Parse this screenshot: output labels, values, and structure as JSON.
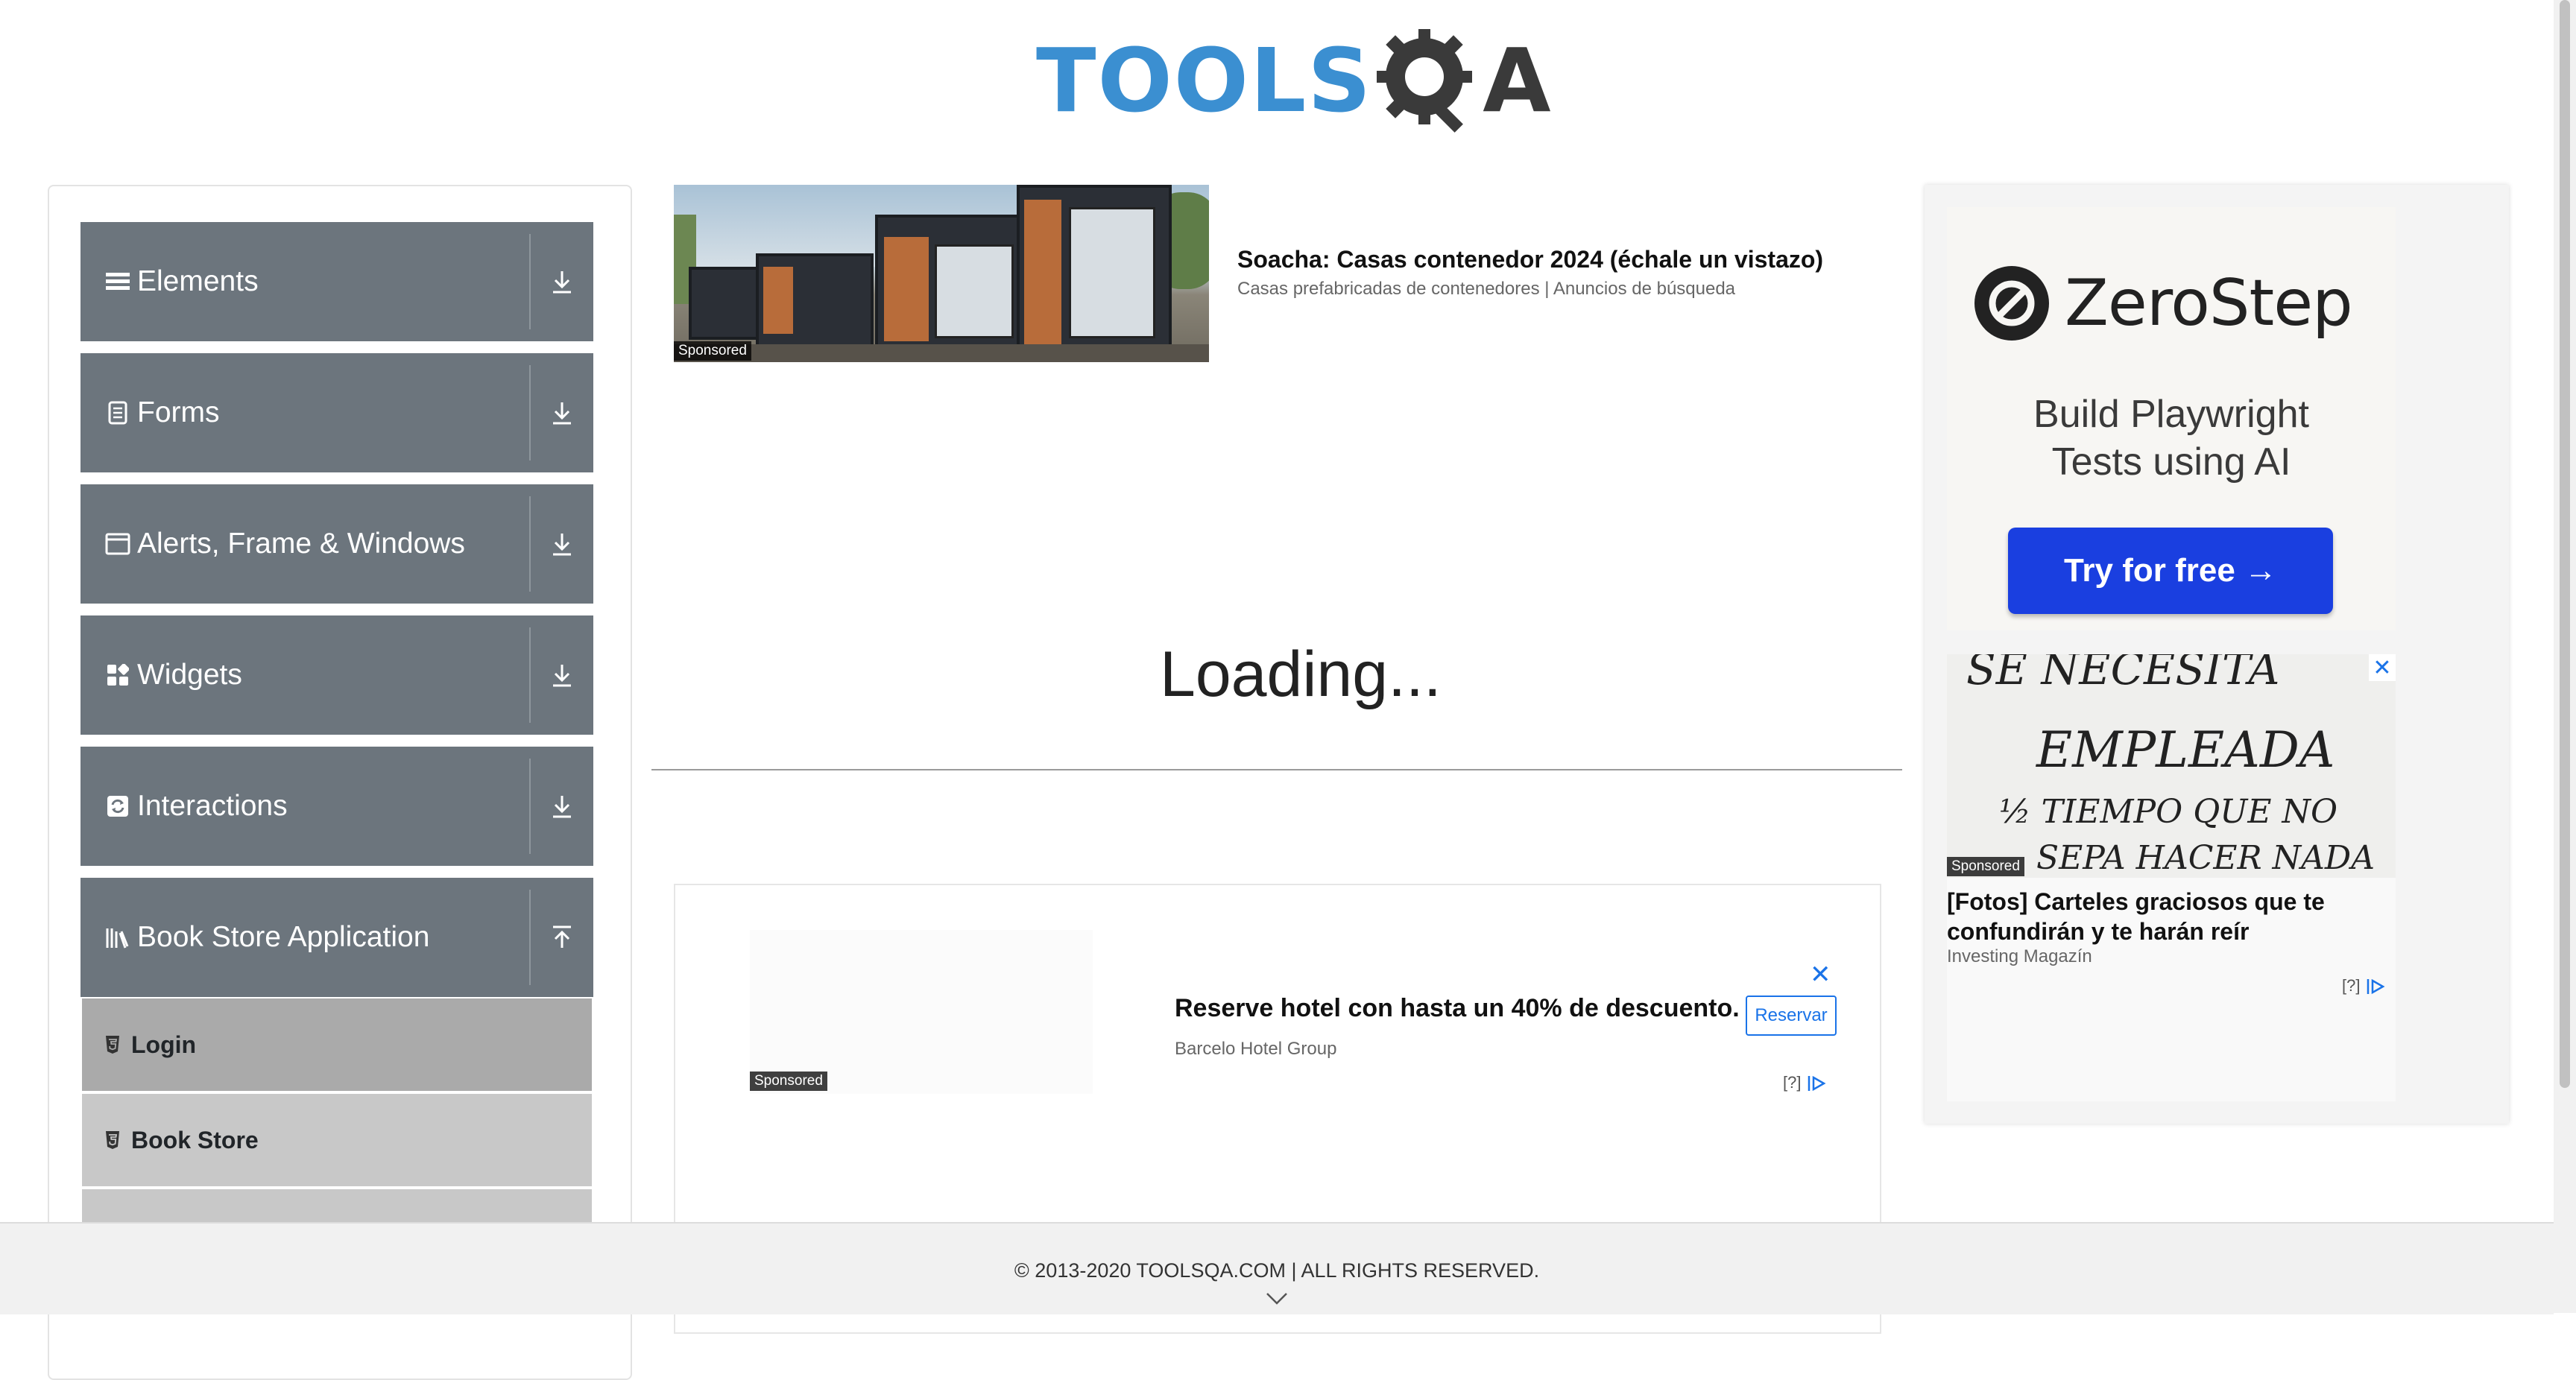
{
  "header": {
    "logo_text_a": "TOOLS",
    "logo_text_b": "A"
  },
  "sidebar": {
    "groups": [
      {
        "label": "Elements",
        "icon": "hamburger-icon",
        "arrow": "download-icon"
      },
      {
        "label": "Forms",
        "icon": "document-icon",
        "arrow": "download-icon"
      },
      {
        "label": "Alerts, Frame & Windows",
        "icon": "window-icon",
        "arrow": "download-icon"
      },
      {
        "label": "Widgets",
        "icon": "grid-icon",
        "arrow": "download-icon"
      },
      {
        "label": "Interactions",
        "icon": "refresh-icon",
        "arrow": "download-icon"
      },
      {
        "label": "Book Store Application",
        "icon": "library-icon",
        "arrow": "upload-icon"
      }
    ],
    "book_store_items": [
      {
        "label": "Login",
        "active": true
      },
      {
        "label": "Book Store",
        "active": false
      },
      {
        "label": "",
        "active": false
      }
    ]
  },
  "ad_top": {
    "badge": "Sponsored",
    "title": "Soacha: Casas contenedor 2024 (échale un vistazo)",
    "subtitle": "Casas prefabricadas de contenedores | Anuncios de búsqueda"
  },
  "main": {
    "loading": "Loading..."
  },
  "ad_mid": {
    "title": "Reserve hotel con hasta un 40% de descuento.",
    "source": "Barcelo Hotel Group",
    "button": "Reservar",
    "badge": "Sponsored",
    "close": "✕",
    "info": "[?]"
  },
  "ad_right": {
    "brand": "ZeroStep",
    "tagline_1": "Build Playwright",
    "tagline_2": "Tests using AI",
    "cta": "Try for free →",
    "card2_badge": "Sponsored",
    "card2_title": "[Fotos] Carteles graciosos que te confundirán y te harán reír",
    "card2_source": "Investing Magazín",
    "card2_info": "[?]",
    "card2_close": "✕",
    "sign_text_1": "SE NECESITA",
    "sign_text_2": "EMPLEADA",
    "sign_text_3": "½ TIEMPO QUE NO",
    "sign_text_4": "SEPA HACER NADA"
  },
  "footer": {
    "copyright": "© 2013-2020 TOOLSQA.COM | ALL RIGHTS RESERVED."
  },
  "colors": {
    "sidebar_group_bg": "#6c757d",
    "logo_blue": "#3b8fd1",
    "cta_blue": "#1a3fe0",
    "active_item_bg": "#aaaaaa",
    "item_bg": "#c8c8c8"
  }
}
